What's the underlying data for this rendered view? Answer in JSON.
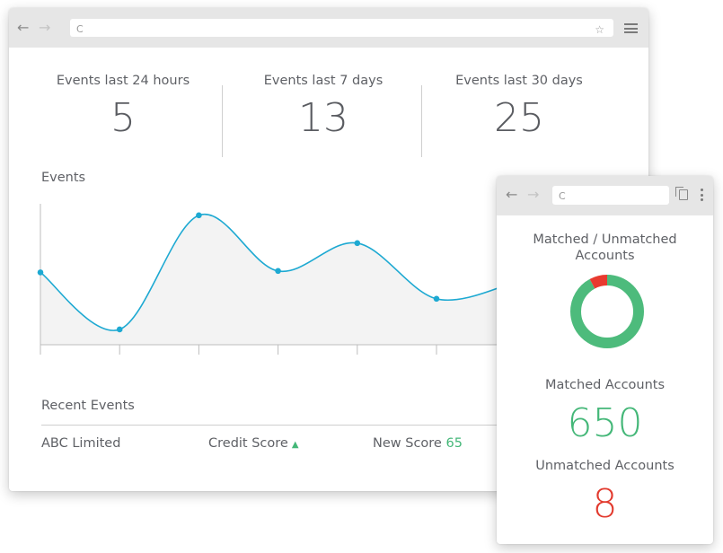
{
  "stats": [
    {
      "label": "Events last 24 hours",
      "value": "5"
    },
    {
      "label": "Events last 7 days",
      "value": "13"
    },
    {
      "label": "Events last 30 days",
      "value": "25"
    }
  ],
  "events_chart": {
    "title": "Events",
    "line_color": "#1da9d2",
    "fill_color": "#f3f3f3"
  },
  "chart_data": {
    "type": "area",
    "title": "Events",
    "x": [
      0,
      1,
      2,
      3,
      4,
      5,
      6
    ],
    "values": [
      0.52,
      0.11,
      0.93,
      0.53,
      0.73,
      0.33,
      0.45
    ],
    "grid": false
  },
  "recent": {
    "title": "Recent Events",
    "rows": [
      {
        "company": "ABC Limited",
        "field": "Credit Score",
        "change_label": "New Score",
        "change_value": "65"
      }
    ]
  },
  "side": {
    "donut_title_1": "Matched / Unmatched",
    "donut_title_2": "Accounts",
    "matched_label": "Matched Accounts",
    "matched_value": "650",
    "unmatched_label": "Unmatched Accounts",
    "unmatched_value": "8",
    "matched_color": "#4dbb7c",
    "unmatched_color": "#e83a2f",
    "donut": {
      "matched_fraction": 0.92,
      "unmatched_fraction": 0.08
    }
  },
  "icons": {
    "back": "←",
    "forward": "→",
    "reload": "C",
    "bookmark": "☆"
  }
}
